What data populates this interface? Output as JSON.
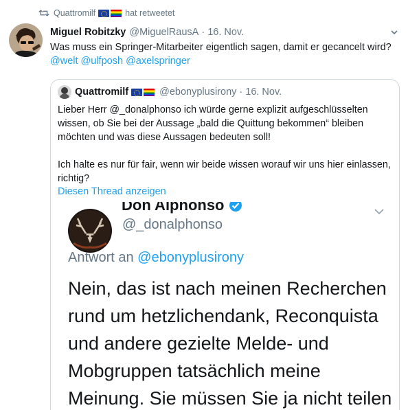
{
  "retweet": {
    "user": "Quattromilf",
    "label": "hat retweetet"
  },
  "tweet": {
    "name": "Miguel Robitzky",
    "handle": "@MiguelRausA",
    "separator": "·",
    "date": "16. Nov.",
    "text": "Was muss ein Springer-Mitarbeiter eigentlich sagen, damit er gecancelt wird?",
    "mentions": [
      "@welt",
      "@ulfposh",
      "@axelspringer"
    ]
  },
  "quote": {
    "name": "Quattromilf",
    "handle": "@ebonyplusirony",
    "separator": "·",
    "date": "16. Nov.",
    "paragraph1": "Lieber Herr @_donalphonso ich würde gerne explizit aufgeschlüsselten wissen, ob Sie bei der Aussage „bald die Quittung bekommen“ bleiben möchten und was diese Aussagen bedeuten soll!",
    "paragraph2": "Ich halte es nur für fair, wenn wir beide wissen worauf wir uns hier einlassen, richtig?",
    "thread_link": "Diesen Thread anzeigen"
  },
  "media": {
    "name": "Don Alphonso",
    "handle": "@_donalphonso",
    "reply_prefix": "Antwort an",
    "reply_to": "@ebonyplusirony",
    "text": "Nein, das ist nach meinen Recherchen rund um hetzlichendank, Reconquista und andere gezielte Melde- und Mobgruppen tatsächlich meine Meinung. Sie müssen Sie ja nicht teilen"
  },
  "colors": {
    "link": "#1da1f2",
    "secondary_text": "#657786",
    "border": "#ccd6dd"
  },
  "icons": [
    "retweet-icon",
    "eu-flag-icon",
    "rainbow-flag-icon",
    "chevron-down-icon",
    "verified-badge-icon"
  ]
}
